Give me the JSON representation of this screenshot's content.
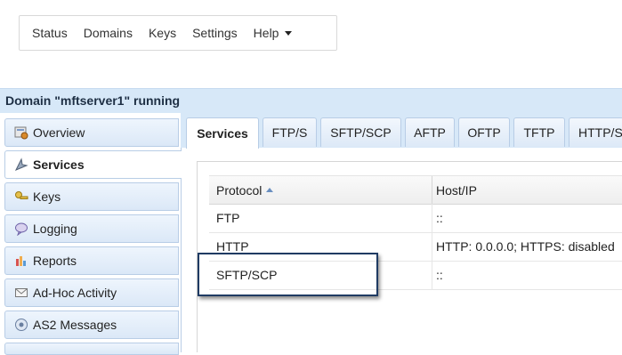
{
  "topnav": {
    "items": [
      {
        "label": "Status"
      },
      {
        "label": "Domains"
      },
      {
        "label": "Keys"
      },
      {
        "label": "Settings"
      },
      {
        "label": "Help"
      }
    ]
  },
  "domain_header": {
    "title": "Domain \"mftserver1\" running"
  },
  "sidebar": {
    "items": [
      {
        "label": "Overview",
        "icon": "overview-icon"
      },
      {
        "label": "Services",
        "icon": "services-icon",
        "active": true
      },
      {
        "label": "Keys",
        "icon": "keys-icon"
      },
      {
        "label": "Logging",
        "icon": "logging-icon"
      },
      {
        "label": "Reports",
        "icon": "reports-icon"
      },
      {
        "label": "Ad-Hoc Activity",
        "icon": "envelope-icon"
      },
      {
        "label": "AS2 Messages",
        "icon": "as2-icon"
      }
    ]
  },
  "tabs": [
    {
      "label": "Services",
      "active": true
    },
    {
      "label": "FTP/S"
    },
    {
      "label": "SFTP/SCP"
    },
    {
      "label": "AFTP"
    },
    {
      "label": "OFTP"
    },
    {
      "label": "TFTP"
    },
    {
      "label": "HTTP/S"
    }
  ],
  "table": {
    "headers": {
      "protocol": "Protocol",
      "host": "Host/IP"
    },
    "rows": [
      {
        "protocol": "FTP",
        "host": "::"
      },
      {
        "protocol": "HTTP",
        "host": "HTTP: 0.0.0.0; HTTPS: disabled"
      },
      {
        "protocol": "SFTP/SCP",
        "host": "::"
      }
    ]
  },
  "colors": {
    "accent": "#d7e8f8",
    "highlight_border": "#1f3b63"
  }
}
